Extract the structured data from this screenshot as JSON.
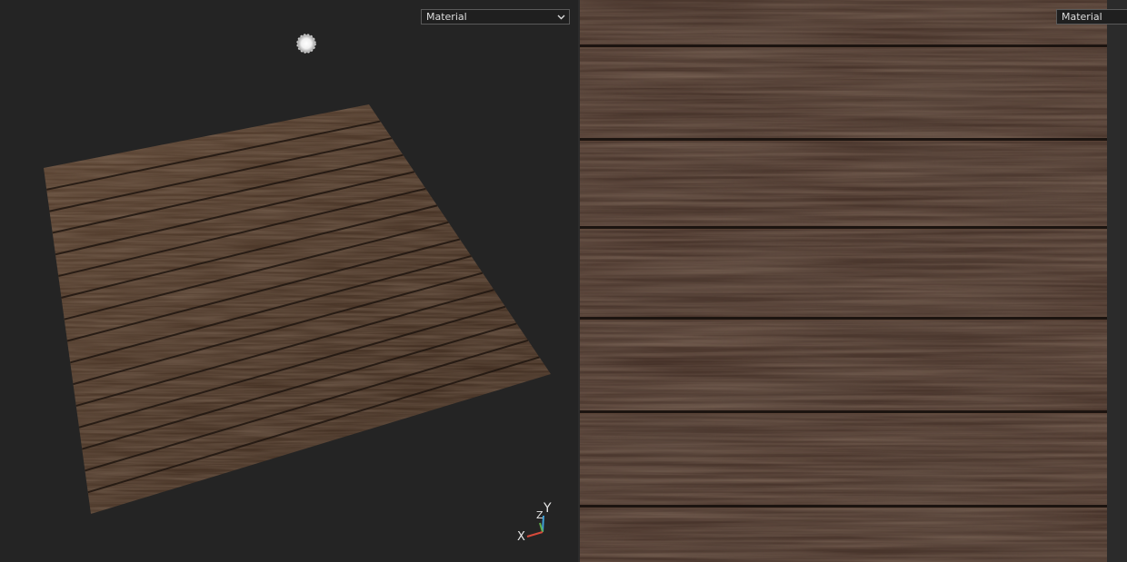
{
  "viewport3d": {
    "material_select": {
      "value": "Material"
    },
    "axis_gizmo": {
      "y_label": "Y",
      "z_label": "Z",
      "x_label": "X"
    },
    "colors": {
      "background": "#242424",
      "wood_base": "#4a3526",
      "plank_gap": "#1f1610"
    }
  },
  "viewport2d": {
    "material_select": {
      "value": "Material"
    },
    "plank_count": 7,
    "colors": {
      "background": "#2a2a2a",
      "wood_base": "#47332a",
      "plank_gap": "#1c1410"
    }
  }
}
